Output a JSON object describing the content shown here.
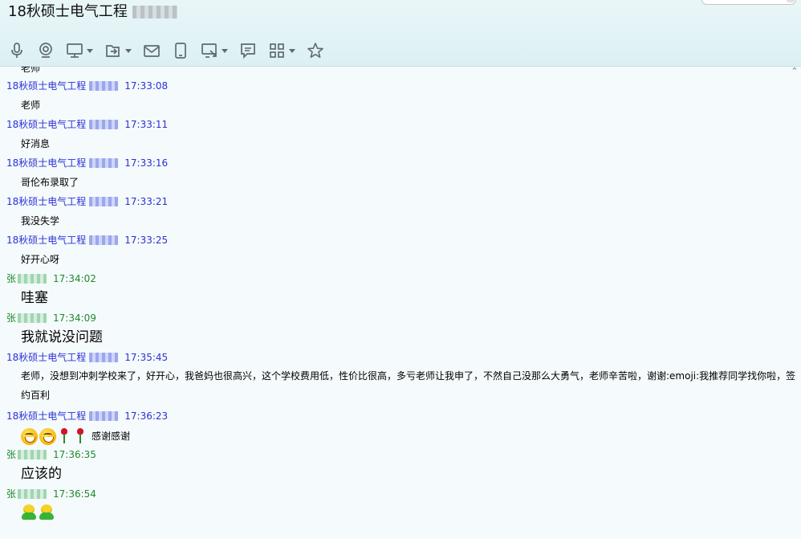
{
  "window": {
    "title": "18秋硕士电气工程"
  },
  "toolbar": {
    "tools": [
      {
        "icon": "microphone-icon"
      },
      {
        "icon": "webcam-icon"
      },
      {
        "icon": "screen-share-icon"
      },
      {
        "icon": "send-file-icon"
      },
      {
        "icon": "mail-icon"
      },
      {
        "icon": "mobile-icon"
      },
      {
        "icon": "remote-desktop-icon"
      },
      {
        "icon": "message-icon"
      },
      {
        "icon": "apps-grid-icon"
      },
      {
        "icon": "star-icon"
      }
    ]
  },
  "chat": {
    "partial_top_text": "老师",
    "messages": [
      {
        "sender": "18秋硕士电气工程",
        "time": "17:33:08",
        "text": "老师"
      },
      {
        "sender": "18秋硕士电气工程",
        "time": "17:33:11",
        "text": "好消息"
      },
      {
        "sender": "18秋硕士电气工程",
        "time": "17:33:16",
        "text": "哥伦布录取了"
      },
      {
        "sender": "18秋硕士电气工程",
        "time": "17:33:21",
        "text": "我没失学"
      },
      {
        "sender": "18秋硕士电气工程",
        "time": "17:33:25",
        "text": "好开心呀"
      },
      {
        "sender": "张",
        "time": "17:34:02",
        "text": "哇塞"
      },
      {
        "sender": "张",
        "time": "17:34:09",
        "text": "我就说没问题"
      },
      {
        "sender": "18秋硕士电气工程",
        "time": "17:35:45",
        "text": "老师，没想到冲刺学校来了，好开心，我爸妈也很高兴，这个学校费用低，性价比很高，多亏老师让我申了，不然自己没那么大勇气，老师辛苦啦，谢谢:emoji:我推荐同学找你啦，签约百利"
      },
      {
        "sender": "18秋硕士电气工程",
        "time": "17:36:23",
        "text": "感谢感谢"
      },
      {
        "sender": "张",
        "time": "17:36:35",
        "text": "应该的"
      },
      {
        "sender": "张",
        "time": "17:36:54",
        "text": ""
      }
    ]
  },
  "colors": {
    "teacher_header": "#2a31d6",
    "student_header": "#1f8a2f",
    "chat_bg": "#f5fafc",
    "titlebar_bg": "#e3f3f6"
  }
}
